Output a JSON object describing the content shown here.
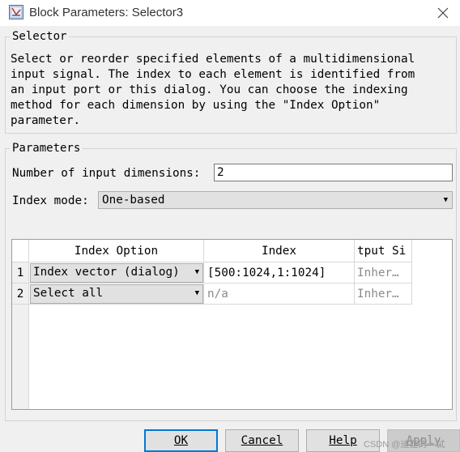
{
  "window": {
    "title": "Block Parameters: Selector3",
    "close_glyph": "✕"
  },
  "selector_group": {
    "label": "Selector",
    "description": "Select or reorder specified elements of a multidimensional\ninput signal. The index to each element is identified from\nan input port or this dialog. You can choose the indexing\nmethod for each dimension by using the \"Index Option\"\nparameter."
  },
  "parameters_group": {
    "label": "Parameters",
    "num_dims_label": "Number of input dimensions:",
    "num_dims_value": "2",
    "index_mode_label": "Index mode:",
    "index_mode_value": "One-based"
  },
  "table": {
    "headers": [
      "Index Option",
      "Index",
      "tput Si"
    ],
    "rows": [
      {
        "num": "1",
        "option": "Index vector (dialog)",
        "index": "[500:1024,1:1024]",
        "output_size": "Inher…"
      },
      {
        "num": "2",
        "option": "Select all",
        "index": "n/a",
        "output_size": "Inher…"
      }
    ]
  },
  "buttons": {
    "ok": "OK",
    "cancel": "Cancel",
    "help": "Help",
    "apply": "Apply"
  },
  "watermark": "CSDN @迪迦的一试"
}
